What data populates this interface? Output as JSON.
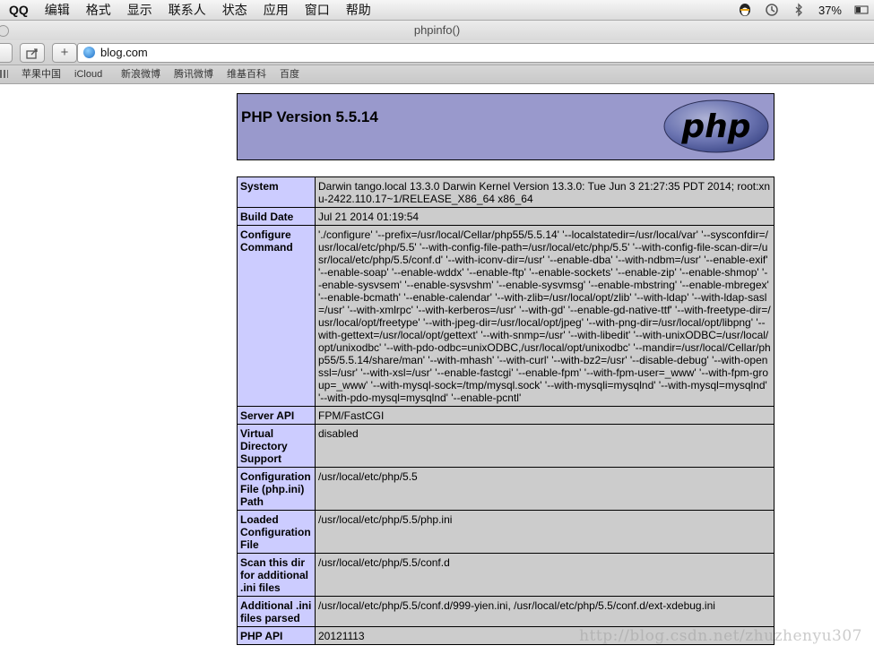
{
  "menubar": {
    "app": "QQ",
    "menus": [
      "编辑",
      "格式",
      "显示",
      "联系人",
      "状态",
      "应用",
      "窗口",
      "帮助"
    ],
    "battery": "37%"
  },
  "window": {
    "title": "phpinfo()"
  },
  "toolbar": {
    "share_label": "⇪",
    "add_label": "+",
    "url": "blog.com"
  },
  "bookmarks": [
    "苹果中国",
    "iCloud",
    "新浪微博",
    "腾讯微博",
    "维基百科",
    "百度"
  ],
  "php": {
    "title": "PHP Version 5.5.14",
    "logo_text": "php",
    "rows": [
      {
        "key": "System",
        "value": "Darwin tango.local 13.3.0 Darwin Kernel Version 13.3.0: Tue Jun 3 21:27:35 PDT 2014; root:xnu-2422.110.17~1/RELEASE_X86_64 x86_64"
      },
      {
        "key": "Build Date",
        "value": "Jul 21 2014 01:19:54"
      },
      {
        "key": "Configure Command",
        "value": "'./configure' '--prefix=/usr/local/Cellar/php55/5.5.14' '--localstatedir=/usr/local/var' '--sysconfdir=/usr/local/etc/php/5.5' '--with-config-file-path=/usr/local/etc/php/5.5' '--with-config-file-scan-dir=/usr/local/etc/php/5.5/conf.d' '--with-iconv-dir=/usr' '--enable-dba' '--with-ndbm=/usr' '--enable-exif' '--enable-soap' '--enable-wddx' '--enable-ftp' '--enable-sockets' '--enable-zip' '--enable-shmop' '--enable-sysvsem' '--enable-sysvshm' '--enable-sysvmsg' '--enable-mbstring' '--enable-mbregex' '--enable-bcmath' '--enable-calendar' '--with-zlib=/usr/local/opt/zlib' '--with-ldap' '--with-ldap-sasl=/usr' '--with-xmlrpc' '--with-kerberos=/usr' '--with-gd' '--enable-gd-native-ttf' '--with-freetype-dir=/usr/local/opt/freetype' '--with-jpeg-dir=/usr/local/opt/jpeg' '--with-png-dir=/usr/local/opt/libpng' '--with-gettext=/usr/local/opt/gettext' '--with-snmp=/usr' '--with-libedit' '--with-unixODBC=/usr/local/opt/unixodbc' '--with-pdo-odbc=unixODBC,/usr/local/opt/unixodbc' '--mandir=/usr/local/Cellar/php55/5.5.14/share/man' '--with-mhash' '--with-curl' '--with-bz2=/usr' '--disable-debug' '--with-openssl=/usr' '--with-xsl=/usr' '--enable-fastcgi' '--enable-fpm' '--with-fpm-user=_www' '--with-fpm-group=_www' '--with-mysql-sock=/tmp/mysql.sock' '--with-mysqli=mysqlnd' '--with-mysql=mysqlnd' '--with-pdo-mysql=mysqlnd' '--enable-pcntl'"
      },
      {
        "key": "Server API",
        "value": "FPM/FastCGI"
      },
      {
        "key": "Virtual Directory Support",
        "value": "disabled"
      },
      {
        "key": "Configuration File (php.ini) Path",
        "value": "/usr/local/etc/php/5.5"
      },
      {
        "key": "Loaded Configuration File",
        "value": "/usr/local/etc/php/5.5/php.ini"
      },
      {
        "key": "Scan this dir for additional .ini files",
        "value": "/usr/local/etc/php/5.5/conf.d"
      },
      {
        "key": "Additional .ini files parsed",
        "value": "/usr/local/etc/php/5.5/conf.d/999-yien.ini, /usr/local/etc/php/5.5/conf.d/ext-xdebug.ini"
      },
      {
        "key": "PHP API",
        "value": "20121113"
      }
    ]
  },
  "watermark": "http://blog.csdn.net/zhuzhenyu307"
}
